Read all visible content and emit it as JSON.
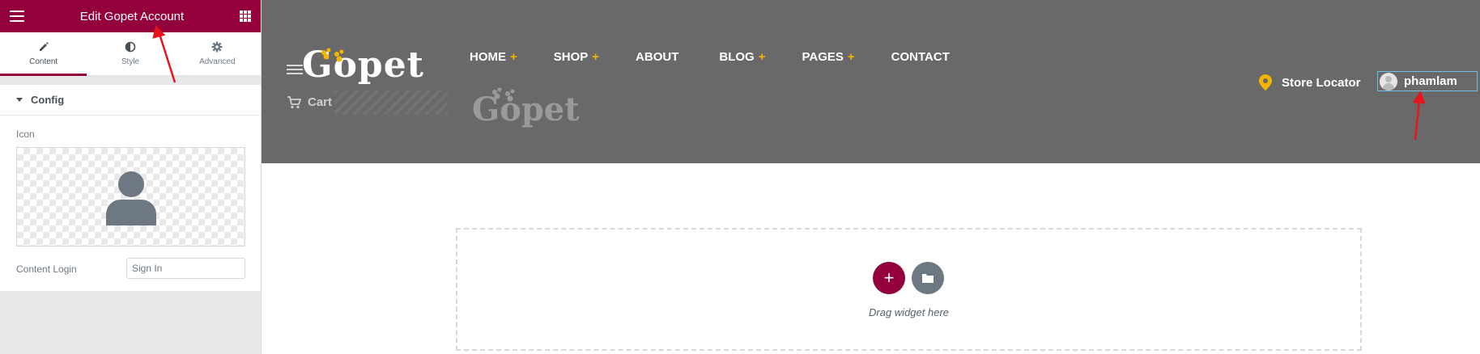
{
  "panel": {
    "title": "Edit Gopet Account",
    "tabs": [
      {
        "label": "Content",
        "icon": "pencil-icon"
      },
      {
        "label": "Style",
        "icon": "half-circle-icon"
      },
      {
        "label": "Advanced",
        "icon": "gear-icon"
      }
    ],
    "section_title": "Config",
    "icon_label": "Icon",
    "content_login_label": "Content Login",
    "content_login_value": "Sign In"
  },
  "site": {
    "logo": "Gopet",
    "cart_label": "Cart",
    "nav": [
      {
        "label": "HOME",
        "plus": "+"
      },
      {
        "label": "SHOP",
        "plus": "+"
      },
      {
        "label": "ABOUT",
        "plus": ""
      },
      {
        "label": "BLOG",
        "plus": "+"
      },
      {
        "label": "PAGES",
        "plus": "+"
      },
      {
        "label": "CONTACT",
        "plus": ""
      }
    ],
    "store_locator": "Store Locator",
    "account_user": "phamlam"
  },
  "drop_zone": {
    "add_symbol": "+",
    "text": "Drag widget here"
  },
  "colors": {
    "accent": "#93003c",
    "header_bg": "#696969",
    "nav_plus": "#f5b400",
    "annotation": "#e8141c"
  }
}
